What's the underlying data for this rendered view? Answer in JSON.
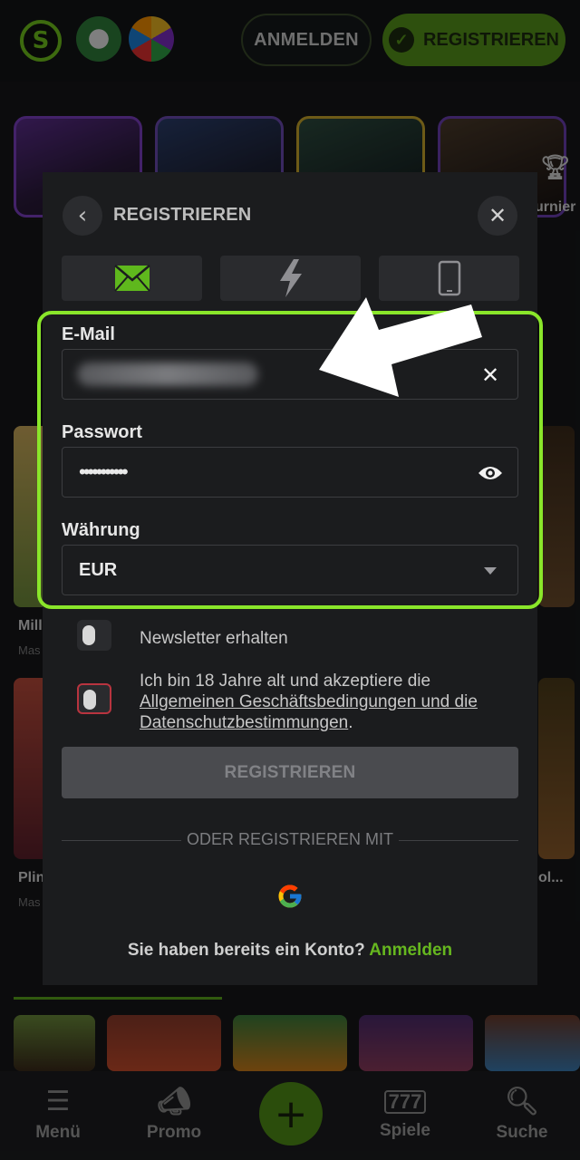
{
  "header": {
    "login_label": "ANMELDEN",
    "register_label": "REGISTRIEREN"
  },
  "background": {
    "side_right_label": "urnier",
    "game_1_title": "Mill",
    "game_1_sub": "Mas",
    "game_2_title": "Plin",
    "game_2_sub": "Mas",
    "game_3_title": "ol..."
  },
  "modal": {
    "title": "REGISTRIEREN",
    "email_label": "E-Mail",
    "password_label": "Passwort",
    "password_value": "•••••••••••",
    "currency_label": "Währung",
    "currency_value": "EUR",
    "newsletter_label": "Newsletter erhalten",
    "terms_text_1": "Ich bin 18 Jahre alt und akzeptiere die ",
    "terms_link": "Allgemeinen Geschäftsbedingungen und die Datenschutzbestimmungen",
    "terms_text_2": ".",
    "submit_label": "REGISTRIEREN",
    "or_label": "ODER REGISTRIEREN MIT",
    "have_account": "Sie haben bereits ein Konto?",
    "login_link": "Anmelden"
  },
  "nav": {
    "menu": "Menü",
    "promo": "Promo",
    "games": "Spiele",
    "search": "Suche"
  },
  "colors": {
    "accent": "#66b71f",
    "highlight": "#8ae62a",
    "error": "#b8343f"
  }
}
